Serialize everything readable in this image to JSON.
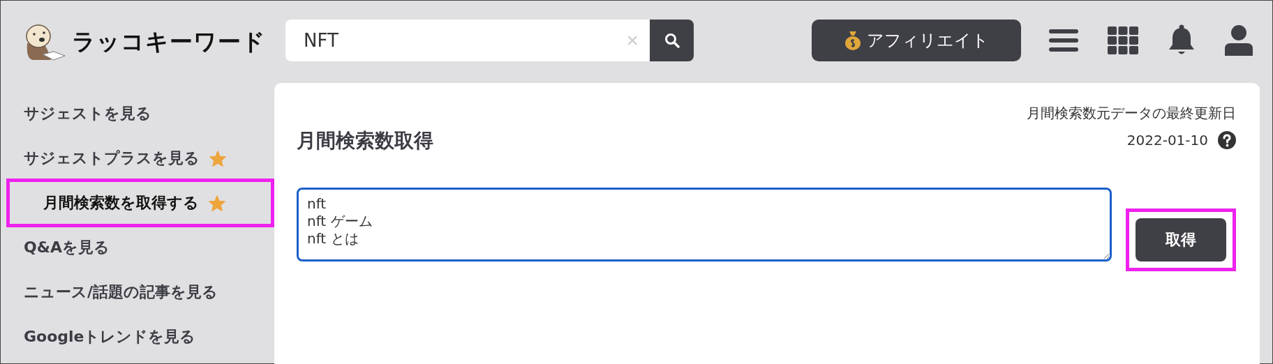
{
  "header": {
    "logo_text": "ラッコキーワード",
    "search": {
      "value": "NFT",
      "clear": "×"
    },
    "affiliate_button": "アフィリエイト"
  },
  "sidebar": {
    "items": [
      {
        "label": "サジェストを見る",
        "starred": false,
        "highlighted": false
      },
      {
        "label": "サジェストプラスを見る",
        "starred": true,
        "highlighted": false
      },
      {
        "label": "月間検索数を取得する",
        "starred": true,
        "highlighted": true
      },
      {
        "label": "Q&Aを見る",
        "starred": false,
        "highlighted": false
      },
      {
        "label": "ニュース/話題の記事を見る",
        "starred": false,
        "highlighted": false
      },
      {
        "label": "Googleトレンドを見る",
        "starred": false,
        "highlighted": false
      }
    ]
  },
  "main": {
    "title": "月間検索数取得",
    "update_label": "月間検索数元データの最終更新日",
    "update_date": "2022-01-10",
    "keywords": "nft\nnft ゲーム\nnft とは",
    "submit": {
      "label": "取得",
      "highlighted": true
    }
  }
}
